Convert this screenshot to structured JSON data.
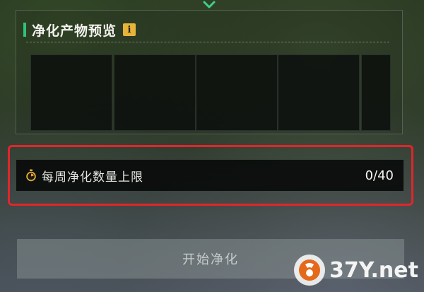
{
  "icons": {
    "top": "chevron-down-icon",
    "info": "info-icon",
    "limit": "stopwatch-icon"
  },
  "colors": {
    "accent": "#2fc27a",
    "info_badge": "#e6b43a",
    "highlight_frame": "#e0262b"
  },
  "preview": {
    "title": "净化产物预览",
    "info_glyph": "i",
    "slots": [
      {
        "state": "empty"
      },
      {
        "state": "empty"
      },
      {
        "state": "empty"
      },
      {
        "state": "empty"
      },
      {
        "state": "empty"
      }
    ]
  },
  "weekly_limit": {
    "label": "每周净化数量上限",
    "count": "0/40"
  },
  "start_button": {
    "label": "开始净化"
  },
  "watermark": {
    "text": "37Y.net"
  }
}
